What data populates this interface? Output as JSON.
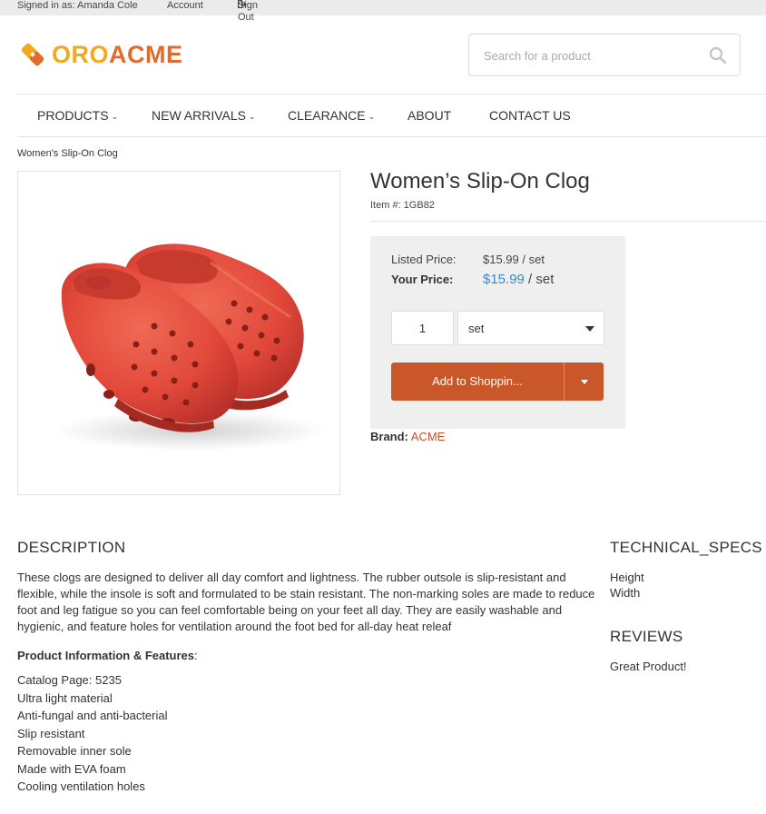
{
  "topbar": {
    "signed_in": "Signed in as: Amanda Cole",
    "account": "Account",
    "sign_out": "Sign Out"
  },
  "logo": {
    "part1": "ORO",
    "part2": "ACME"
  },
  "search": {
    "placeholder": "Search for a product"
  },
  "nav": {
    "items": [
      {
        "label": "PRODUCTS"
      },
      {
        "label": "NEW ARRIVALS"
      },
      {
        "label": "CLEARANCE"
      },
      {
        "label": "ABOUT"
      },
      {
        "label": "CONTACT US"
      }
    ]
  },
  "breadcrumb": "Women's Slip-On Clog",
  "product": {
    "title": "Women’s Slip-On Clog",
    "item_number": "Item #: 1GB82",
    "listed_price_label": "Listed Price:",
    "listed_price_value": "$15.99 / set",
    "your_price_label": "Your Price:",
    "your_price_amount": "$15.99",
    "your_price_unit": " / set",
    "quantity": "1",
    "unit": "set",
    "add_button": "Add to Shoppin...",
    "brand_label": "Brand:",
    "brand_value": "ACME"
  },
  "description": {
    "title": "DESCRIPTION",
    "text": "These clogs are designed to deliver all day comfort and lightness. The rubber outsole is slip-resistant and flexible, while the insole is soft and formulated to be stain resistant. The non-marking soles are made to reduce foot and leg fatigue so you can feel comfortable being on your feet all day. They are easily washable and hygienic, and feature holes for ventilation around the foot bed for all-day heat releaf",
    "features_title": "Product Information & Features",
    "features_colon": ":",
    "features": [
      "Catalog Page: 5235",
      "Ultra light material",
      "Anti-fungal and anti-bacterial",
      "Slip resistant",
      "Removable inner sole",
      "Made with EVA foam",
      "Cooling ventilation holes"
    ]
  },
  "specs": {
    "title": "TECHNICAL_SPECS",
    "items": [
      "Height",
      "Width"
    ]
  },
  "reviews": {
    "title": "REVIEWS",
    "text": "Great Product!"
  },
  "colors": {
    "accent": "#c9572a",
    "price_blue": "#3b86c6",
    "logo_yellow": "#f2a91e",
    "logo_orange": "#e26a2c",
    "shoe_red": "#e2483a"
  }
}
